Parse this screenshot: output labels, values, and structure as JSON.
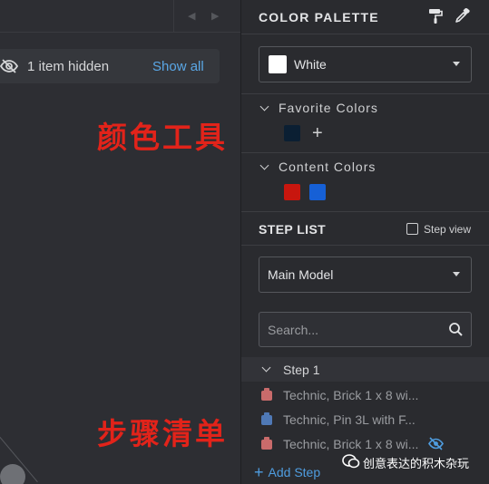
{
  "viewport": {
    "hidden_text": "1 item hidden",
    "show_all_label": "Show all",
    "annotation_color_tools": "颜色工具",
    "annotation_step_list": "步骤清单"
  },
  "color_palette": {
    "title": "COLOR PALETTE",
    "selected_color": {
      "label": "White",
      "hex": "#ffffff"
    },
    "favorite_group": {
      "label": "Favorite Colors",
      "colors": [
        "#0b1f33"
      ]
    },
    "content_group": {
      "label": "Content Colors",
      "colors": [
        "#c8160e",
        "#1660d6"
      ]
    },
    "icons": [
      "paint-roller-icon",
      "eyedropper-icon"
    ]
  },
  "step_list": {
    "title": "STEP LIST",
    "step_view_label": "Step view",
    "step_view_checked": false,
    "model_select": "Main Model",
    "search_placeholder": "Search...",
    "steps": [
      {
        "label": "Step 1",
        "parts": [
          {
            "label": "Technic, Brick 1 x 8 wi...",
            "color": "#c96b6b",
            "hidden": false
          },
          {
            "label": "Technic, Pin 3L with F...",
            "color": "#4f79b6",
            "hidden": false
          },
          {
            "label": "Technic, Brick 1 x 8 wi...",
            "color": "#c96b6b",
            "hidden": true
          }
        ]
      }
    ],
    "add_step_label": "Add Step"
  },
  "watermark": {
    "text": "创意表达的积木杂玩"
  },
  "accent": "#5aa7e6"
}
